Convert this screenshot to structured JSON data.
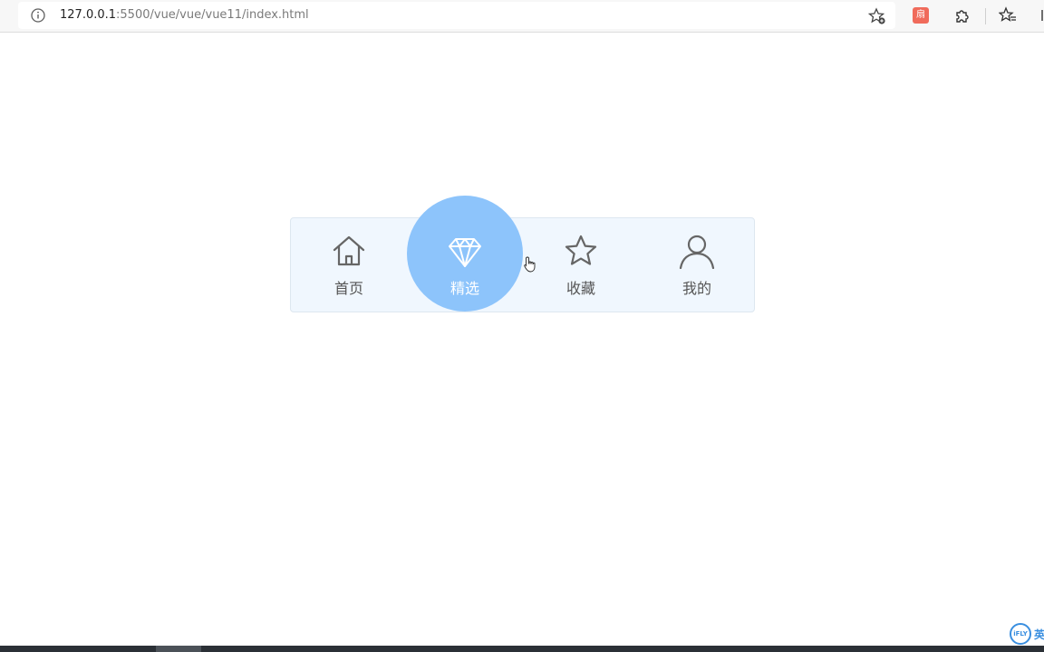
{
  "browser": {
    "url_host": "127.0.0.1",
    "url_rest": ":5500/vue/vue/vue11/index.html",
    "extension_badge": "扇"
  },
  "tabbar": {
    "active_color": "#8dc4fb",
    "background_color": "#f0f7fe",
    "items": [
      {
        "label": "首页",
        "icon": "home-icon",
        "active": false
      },
      {
        "label": "精选",
        "icon": "diamond-icon",
        "active": true
      },
      {
        "label": "收藏",
        "icon": "star-icon",
        "active": false
      },
      {
        "label": "我的",
        "icon": "user-icon",
        "active": false
      }
    ]
  },
  "ime": {
    "badge": "iFLY",
    "text": "英"
  }
}
